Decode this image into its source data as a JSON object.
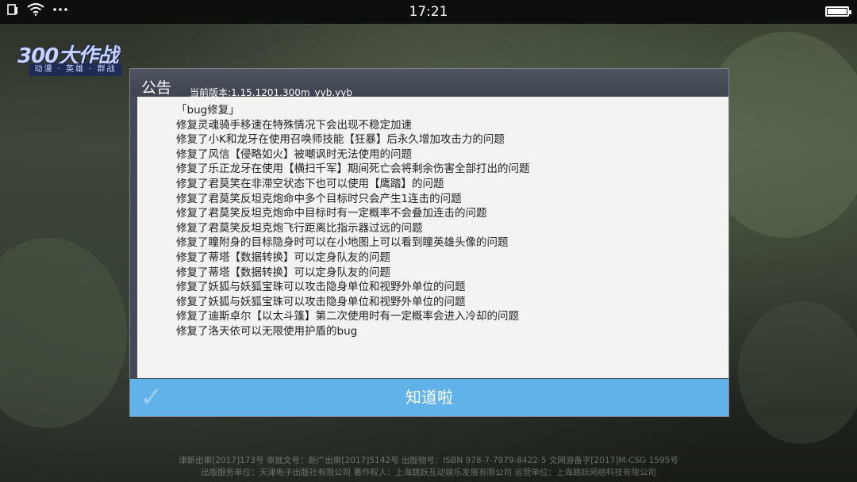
{
  "status_bar": {
    "time": "17:21",
    "icons": [
      "sim-icon",
      "wifi-icon",
      "more-icon",
      "battery-icon"
    ]
  },
  "logo": {
    "main": "300大作战",
    "sub": "动漫 · 英雄 · 群战"
  },
  "dialog": {
    "title": "公告",
    "version": "当前版本:1.15.1201.300m_yyb.yyb",
    "notes": [
      "「bug修复」",
      "修复灵魂骑手移速在特殊情况下会出现不稳定加速",
      "修复了小K和龙牙在使用召唤师技能【狂暴】后永久增加攻击力的问题",
      "修复了风信【侵略如火】被嘲讽时无法使用的问题",
      "修复了乐正龙牙在使用【横扫千军】期间死亡会将剩余伤害全部打出的问题",
      "修复了君莫笑在非滞空状态下也可以使用【鹰踏】的问题",
      "修复了君莫笑反坦克炮命中多个目标时只会产生1连击的问题",
      "修复了君莫笑反坦克炮命中目标时有一定概率不会叠加连击的问题",
      "修复了君莫笑反坦克炮飞行距离比指示器过远的问题",
      "修复了瞳附身的目标隐身时可以在小地图上可以看到瞳英雄头像的问题",
      "修复了蒂塔【数据转换】可以定身队友的问题",
      "修复了蒂塔【数据转换】可以定身队友的问题",
      "修复了妖狐与妖狐宝珠可以攻击隐身单位和视野外单位的问题",
      "修复了妖狐与妖狐宝珠可以攻击隐身单位和视野外单位的问题",
      "修复了迪斯卓尔【以太斗篷】第二次使用时有一定概率会进入冷却的问题",
      "修复了洛天依可以无限使用护盾的bug"
    ],
    "ok_label": "知道啦"
  },
  "footer": {
    "line1": "津新出审[2017]173号  审批文号：新广出审[2017]5142号  出版物号：ISBN 978-7-7979-8422-5  文网游备字[2017]M-CSG 1595号",
    "line2": "出版服务单位：天津电子出版社有限公司  著作权人：上海跳跃互动娱乐发展有限公司  运营单位：上海跳跃网络科技有限公司"
  },
  "colors": {
    "accent": "#62b2ea",
    "dialog_frame": "#444a55",
    "body_bg": "#f3f3f1"
  }
}
